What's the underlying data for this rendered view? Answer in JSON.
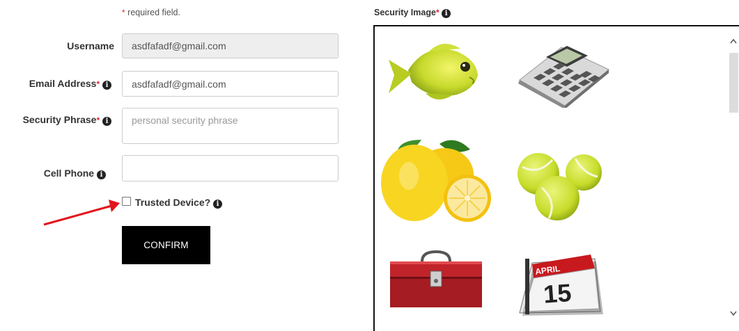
{
  "form": {
    "required_note": "required field.",
    "required_star": "*",
    "username": {
      "label": "Username",
      "value": "asdfafadf@gmail.com"
    },
    "email": {
      "label": "Email Address",
      "value": "asdfafadf@gmail.com"
    },
    "security_phrase": {
      "label": "Security Phrase",
      "placeholder": "personal security phrase"
    },
    "cell_phone": {
      "label": "Cell Phone",
      "value": ""
    },
    "trusted_device": {
      "label": "Trusted Device?",
      "checked": false
    },
    "confirm_label": "CONFIRM",
    "info_glyph": "i"
  },
  "security_image": {
    "title": "Security Image",
    "images": [
      {
        "name": "yellow-fish",
        "selected": false
      },
      {
        "name": "calculator",
        "selected": false
      },
      {
        "name": "lemons",
        "selected": false
      },
      {
        "name": "tennis-balls",
        "selected": false
      },
      {
        "name": "red-toolbox",
        "selected": false
      },
      {
        "name": "calendar-april-15",
        "selected": false
      }
    ],
    "calendar_month": "APRIL",
    "calendar_day": "15"
  },
  "colors": {
    "required": "#e0262b",
    "confirm_bg": "#000000",
    "annotation_arrow": "#e3141b"
  }
}
